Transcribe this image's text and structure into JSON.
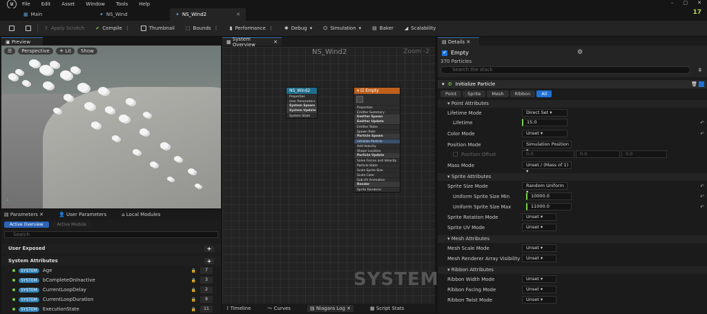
{
  "menu": [
    "File",
    "Edit",
    "Asset",
    "Window",
    "Tools",
    "Help"
  ],
  "tabs": [
    {
      "label": "Main",
      "active": false
    },
    {
      "label": "NS_Wind",
      "active": false
    },
    {
      "label": "NS_Wind2",
      "active": true
    }
  ],
  "brand": "17",
  "toolbar": {
    "apply": "Apply Scratch",
    "compile": "Compile",
    "thumbnail": "Thumbnail",
    "bounds": "Bounds",
    "performance": "Performance",
    "debug": "Debug",
    "simulation": "Simulation",
    "baker": "Baker",
    "scalability": "Scalability"
  },
  "preview": {
    "tab": "Preview",
    "perspective": "Perspective",
    "lit": "Lit",
    "show": "Show"
  },
  "params": {
    "tabs": [
      "Parameters",
      "User Parameters",
      "Local Modules"
    ],
    "sub": [
      "Active Overview",
      "Active Module"
    ],
    "search": "Search",
    "user_exposed": "User Exposed",
    "system_attributes": "System Attributes",
    "rows": [
      {
        "tag": "SYSTEM",
        "name": "Age",
        "value": "7"
      },
      {
        "tag": "SYSTEM",
        "name": "bCompleteOnInactive",
        "value": "3"
      },
      {
        "tag": "SYSTEM",
        "name": "CurrentLoopDelay",
        "value": "2"
      },
      {
        "tag": "SYSTEM",
        "name": "CurrentLoopDuration",
        "value": "9"
      },
      {
        "tag": "SYSTEM",
        "name": "ExecutionState",
        "value": "11"
      }
    ]
  },
  "overview": {
    "tab": "System Overview",
    "title": "NS_Wind2",
    "zoom": "Zoom -2",
    "watermark": "SYSTEM",
    "sys_node": {
      "title": "NS_Wind2",
      "rows": [
        "Properties",
        "User Parameters",
        "System Spawn",
        "System Update",
        "System State"
      ]
    },
    "emit_node": {
      "title": "Empty",
      "rows": [
        "Properties",
        "Emitter Summary",
        "Emitter Spawn",
        "Emitter Update",
        "Emitter State",
        "Spawn Rate",
        "Particle Spawn",
        "Initialize Particle",
        "Add Velocity",
        "Shape Location",
        "Particle Update",
        "Solve Forces and Velocity",
        "Particle State",
        "Scale Sprite Size",
        "Scale Color",
        "Sub UV Animation",
        "Render",
        "Sprite Renderer"
      ]
    },
    "bottom_tabs": [
      "Timeline",
      "Curves",
      "Niagara Log",
      "Script Stats"
    ]
  },
  "details": {
    "tab": "Details",
    "emitter": "Empty",
    "particles": "370 Particles",
    "search": "Search the stack",
    "module": "Initialize Particle",
    "filters": [
      "Point",
      "Sprite",
      "Mesh",
      "Ribbon",
      "All"
    ],
    "sections": {
      "point": "Point Attributes",
      "sprite": "Sprite Attributes",
      "mesh": "Mesh Attributes",
      "ribbon": "Ribbon Attributes"
    },
    "rows": {
      "lifetime_mode": {
        "label": "Lifetime Mode",
        "value": "Direct Set"
      },
      "lifetime": {
        "label": "Lifetime",
        "value": "15.0"
      },
      "color_mode": {
        "label": "Color Mode",
        "value": "Unset"
      },
      "position_mode": {
        "label": "Position Mode",
        "value": "Simulation Position"
      },
      "position_offset": {
        "label": "Position Offset",
        "x": "0.0",
        "y": "0.0",
        "z": "0.0"
      },
      "mass_mode": {
        "label": "Mass Mode",
        "value": "Unset / (Mass of 1)"
      },
      "sprite_size_mode": {
        "label": "Sprite Size Mode",
        "value": "Random Uniform"
      },
      "size_min": {
        "label": "Uniform Sprite Size Min",
        "value": "10000.0"
      },
      "size_max": {
        "label": "Uniform Sprite Size Max",
        "value": "11000.0"
      },
      "sprite_rot": {
        "label": "Sprite Rotation Mode",
        "value": "Unset"
      },
      "sprite_uv": {
        "label": "Sprite UV Mode",
        "value": "Unset"
      },
      "mesh_scale": {
        "label": "Mesh Scale Mode",
        "value": "Unset"
      },
      "mesh_vis": {
        "label": "Mesh Renderer Array Visibility Mode",
        "value": "Unset"
      },
      "ribbon_width": {
        "label": "Ribbon Width Mode",
        "value": "Unset"
      },
      "ribbon_facing": {
        "label": "Ribbon Facing Mode",
        "value": "Unset"
      },
      "ribbon_twist": {
        "label": "Ribbon Twist Mode",
        "value": "Unset"
      }
    }
  }
}
